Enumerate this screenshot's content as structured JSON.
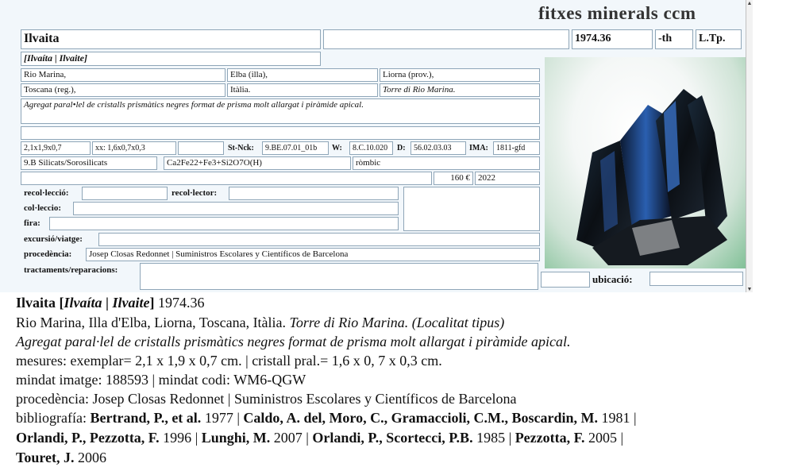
{
  "app_title": "fitxes minerals ccm",
  "record": {
    "name": "Ilvaita",
    "blank_top": "",
    "number": "1974.36",
    "suffix": "-th",
    "type_locality": "L.Tp.",
    "synonyms": "[Ilvaíta | Ilvaite]",
    "loc1": "Rio Marina,",
    "loc2": "Elba (illa),",
    "loc3": "Liorna (prov.),",
    "loc4": "Toscana (reg.),",
    "loc5": "Itàlia.",
    "loc6": "Torre di Rio Marina.",
    "description": "Agregat paral•lel de cristalls prismàtics negres format de prisma molt allargat i piràmide apical.",
    "size1": "2,1x1,9x0,7",
    "size2": "xx: 1,6x0,7x0,3",
    "strunz_label": "St-Nck:",
    "strunz": "9.BE.07.01_01b",
    "w_label": "W:",
    "w": "8.C.10.020",
    "d_label": "D:",
    "d": "56.02.03.03",
    "ima_label": "IMA:",
    "ima": "1811-gfd",
    "class": "9.B Silicats/Sorosilicats",
    "formula": "Ca2Fe22+Fe3+Si2O7O(H)",
    "system": "ròmbic",
    "price": "160 €",
    "year": "2022",
    "recoleccio_label": "recol·lecció:",
    "recolector_label": "recol·lector:",
    "colleccio_label": "col·leccio:",
    "fira_label": "fira:",
    "excursio_label": "excursió/viatge:",
    "procedencia_label": "procedència:",
    "procedencia": "Josep Closas Redonnet | Suministros Escolares y Científicos de Barcelona",
    "tractaments_label": "tractaments/reparacions:",
    "ubicacio_label": "ubicació:"
  },
  "summary": {
    "l1_name": "Ilvaita",
    "l1_syn_open": " [",
    "l1_syn_a": "Ilvaíta",
    "l1_syn_sep": " | ",
    "l1_syn_b": "Ilvaite",
    "l1_syn_close": "]",
    "l1_num": " 1974.36",
    "l2_plain": "Rio Marina, Illa d'Elba, Liorna, Toscana, Itàlia. ",
    "l2_italic": "Torre di Rio Marina. (Localitat tipus)",
    "l3": "Agregat paral·lel de cristalls prismàtics negres format de prisma molt allargat i piràmide apical.",
    "l4": "mesures: exemplar= 2,1 x 1,9 x 0,7 cm. | cristall pral.= 1,6 x 0, 7 x 0,3 cm.",
    "l5": "mindat imatge: 188593 | mindat codi: WM6-QGW",
    "l6": "procedència: Josep Closas Redonnet | Suministros Escolares y Científicos de Barcelona",
    "biblio_label": "bibliografía: ",
    "b1_author": "Bertrand, P., et al.",
    "b1_year": " 1977 | ",
    "b2_author": "Caldo, A. del, Moro, C., Gramaccioli, C.M., Boscardin, M.",
    "b2_year": " 1981 |",
    "b3_author": "Orlandi, P., Pezzotta, F.",
    "b3_year": " 1996 | ",
    "b4_author": "Lunghi, M.",
    "b4_year": " 2007 | ",
    "b5_author": "Orlandi, P., Scortecci, P.B.",
    "b5_year": " 1985 | ",
    "b6_author": "Pezzotta, F.",
    "b6_year": " 2005 |",
    "b7_author": "Touret, J.",
    "b7_year": " 2006"
  },
  "icons": [
    "scroll-up-icon",
    "scroll-down-icon",
    "mineral-photo"
  ],
  "colors": {
    "form_bg": "#f2f7fb",
    "field_border": "#8fa6b8",
    "photo_green": "#7fbf95"
  }
}
